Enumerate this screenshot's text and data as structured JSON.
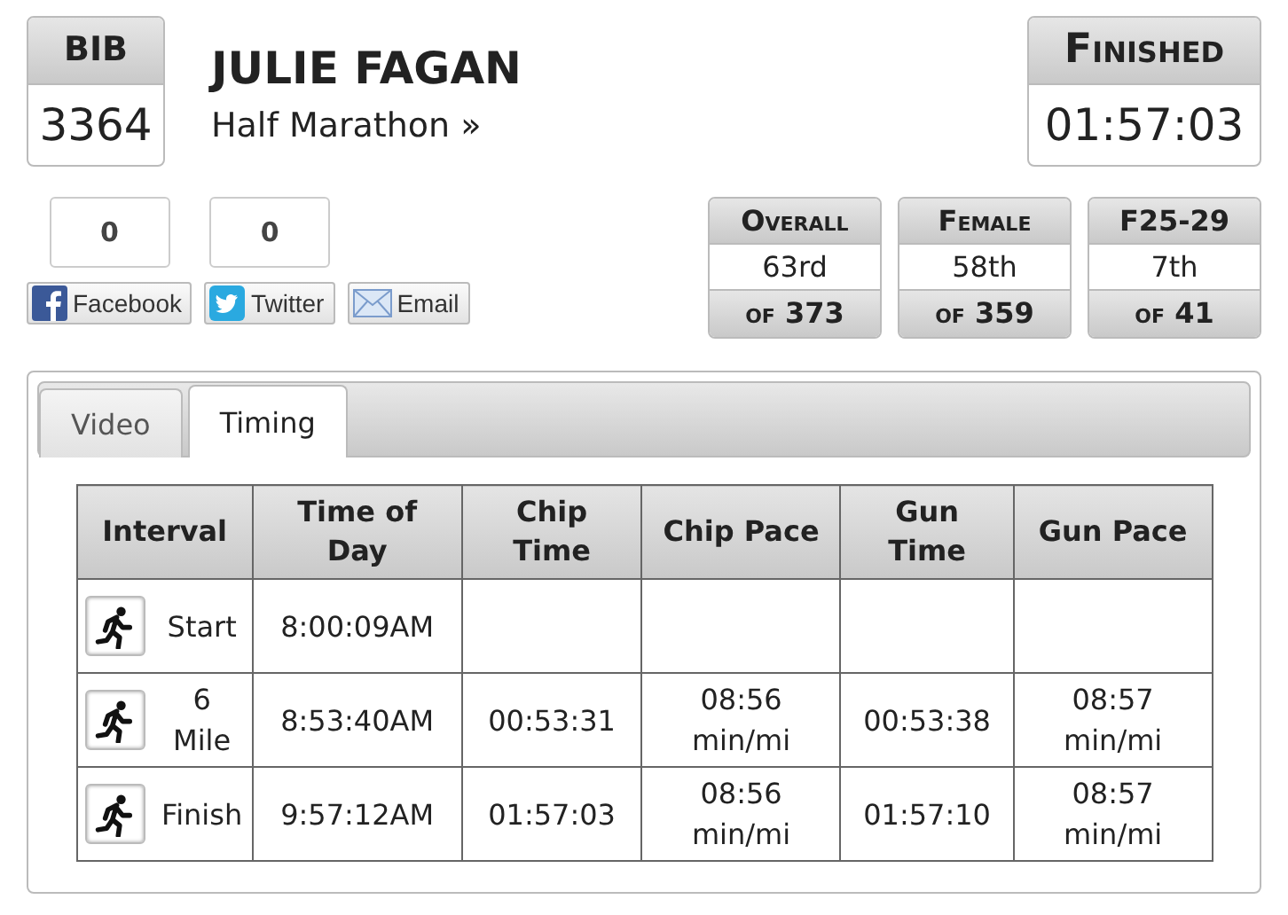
{
  "bib": {
    "label": "BIB",
    "number": "3364"
  },
  "athlete": {
    "name": "JULIE FAGAN",
    "race": "Half Marathon »"
  },
  "result": {
    "label": "Finished",
    "time": "01:57:03"
  },
  "shares": [
    {
      "kind": "facebook",
      "label": "Facebook",
      "count": "0"
    },
    {
      "kind": "twitter",
      "label": "Twitter",
      "count": "0"
    },
    {
      "kind": "email",
      "label": "Email"
    }
  ],
  "ranks": [
    {
      "label": "Overall",
      "place": "63rd",
      "of": "of",
      "total": "373"
    },
    {
      "label": "Female",
      "place": "58th",
      "of": "of",
      "total": "359"
    },
    {
      "label": "F25-29",
      "place": "7th",
      "of": "of",
      "total": "41"
    }
  ],
  "tabs": [
    {
      "label": "Video",
      "selected": false
    },
    {
      "label": "Timing",
      "selected": true
    }
  ],
  "table": {
    "columns": [
      "Interval",
      "Time of Day",
      "Chip Time",
      "Chip Pace",
      "Gun Time",
      "Gun Pace"
    ],
    "rows": [
      [
        "Start",
        "8:00:09AM",
        "",
        "",
        "",
        ""
      ],
      [
        "6 Mile",
        "8:53:40AM",
        "00:53:31",
        "08:56 min/mi",
        "00:53:38",
        "08:57 min/mi"
      ],
      [
        "Finish",
        "9:57:12AM",
        "01:57:03",
        "08:56 min/mi",
        "01:57:10",
        "08:57 min/mi"
      ]
    ]
  }
}
